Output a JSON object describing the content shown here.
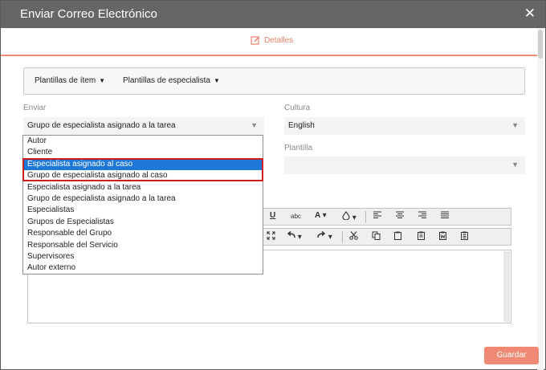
{
  "dialog": {
    "title": "Enviar Correo Electrónico",
    "close_glyph": "✕"
  },
  "tabs": [
    {
      "label": "Detalles"
    }
  ],
  "templates": {
    "item_label": "Plantillas de ítem",
    "specialist_label": "Plantillas de especialista",
    "caret": "▼"
  },
  "send": {
    "label": "Enviar",
    "value": "Grupo de especialista asignado a la tarea",
    "arrow": "▼"
  },
  "culture": {
    "label": "Cultura",
    "value": "English",
    "arrow": "▼"
  },
  "template": {
    "label": "Plantilla",
    "value": "",
    "arrow": "▼"
  },
  "dropdown": {
    "options": [
      "Autor",
      "Cliente",
      "Especialista asignado al caso",
      "Grupo de especialista asignado al caso",
      "Especialista asignado a la tarea",
      "Grupo de especialista asignado a la tarea",
      "Especialistas",
      "Grupos de Especialistas",
      "Responsable del Grupo",
      "Responsable del Servicio",
      "Supervisores",
      "Autor externo"
    ],
    "selected": "Especialista asignado al caso"
  },
  "toolbar": {
    "underline": "U",
    "strike": "abc",
    "font_color": "A",
    "caret": "▾"
  },
  "footer": {
    "save_label": "Guardar"
  },
  "colors": {
    "accent": "#f08a75",
    "selection": "#1e78d8",
    "highlight": "#cc1f1f",
    "titlebar": "#666666"
  }
}
